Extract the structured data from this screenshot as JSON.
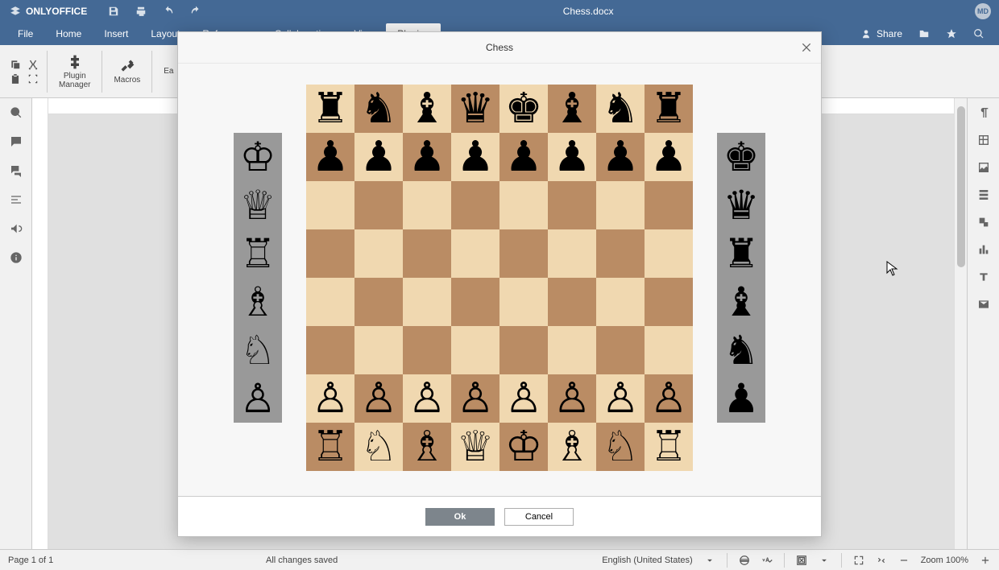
{
  "app": {
    "brand": "ONLYOFFICE",
    "doc_title": "Chess.docx",
    "avatar_initials": "MD"
  },
  "menu": {
    "items": [
      "File",
      "Home",
      "Insert",
      "Layout",
      "References",
      "Collaboration",
      "View",
      "Plugins"
    ],
    "active": "Plugins",
    "share": "Share"
  },
  "ribbon": {
    "plugin_manager": "Plugin\nManager",
    "macros": "Macros",
    "ea": "Ea"
  },
  "status": {
    "page": "Page 1 of 1",
    "saved": "All changes saved",
    "language": "English (United States)",
    "zoom": "Zoom 100%"
  },
  "modal": {
    "title": "Chess",
    "ok": "Ok",
    "cancel": "Cancel"
  },
  "chess": {
    "pieces": {
      "wk": "♔",
      "wq": "♕",
      "wr": "♖",
      "wb": "♗",
      "wn": "♘",
      "wp": "♙",
      "bk": "♚",
      "bq": "♛",
      "br": "♜",
      "bb": "♝",
      "bn": "♞",
      "bp": "♟"
    },
    "board": [
      [
        "br",
        "bn",
        "bb",
        "bq",
        "bk",
        "bb",
        "bn",
        "br"
      ],
      [
        "bp",
        "bp",
        "bp",
        "bp",
        "bp",
        "bp",
        "bp",
        "bp"
      ],
      [
        "",
        "",
        "",
        "",
        "",
        "",
        "",
        ""
      ],
      [
        "",
        "",
        "",
        "",
        "",
        "",
        "",
        ""
      ],
      [
        "",
        "",
        "",
        "",
        "",
        "",
        "",
        ""
      ],
      [
        "",
        "",
        "",
        "",
        "",
        "",
        "",
        ""
      ],
      [
        "wp",
        "wp",
        "wp",
        "wp",
        "wp",
        "wp",
        "wp",
        "wp"
      ],
      [
        "wr",
        "wn",
        "wb",
        "wq",
        "wk",
        "wb",
        "wn",
        "wr"
      ]
    ],
    "captured_left": [
      "wk",
      "wq",
      "wr",
      "wb",
      "wn",
      "wp"
    ],
    "captured_right": [
      "bk",
      "bq",
      "br",
      "bb",
      "bn",
      "bp"
    ]
  }
}
